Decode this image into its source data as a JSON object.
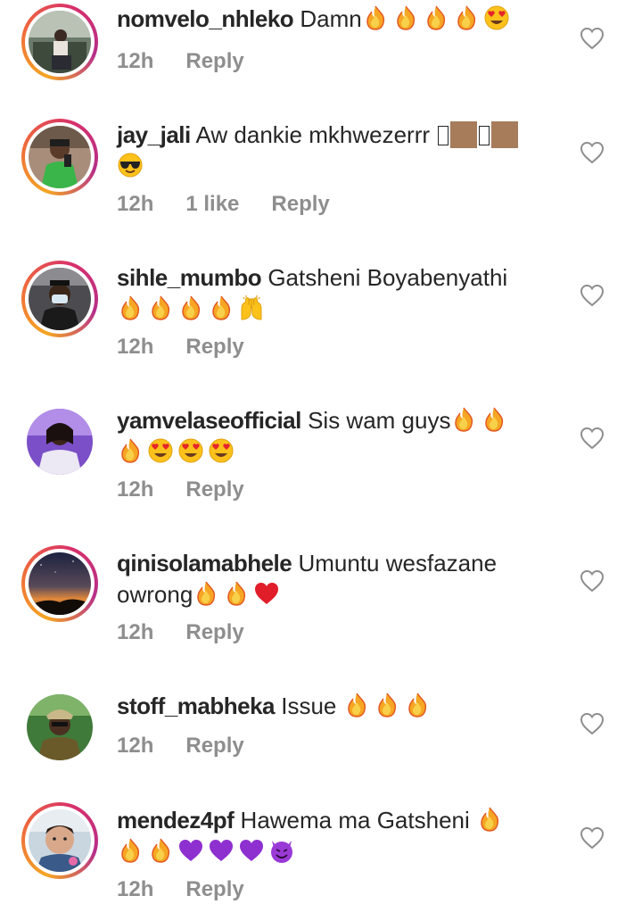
{
  "comments": [
    {
      "username": "nomvelo_nhleko",
      "text": "Damn",
      "line2": "",
      "emoji_line1": [
        "fire-emoji",
        "fire-emoji",
        "fire-emoji",
        "fire-emoji",
        "heart-eyes-emoji"
      ],
      "emoji_line2": [],
      "time": "12h",
      "likes": "",
      "reply": "Reply",
      "avatar": "avatar-photo-man-outdoor",
      "story_ring": true
    },
    {
      "username": "jay_jali",
      "text": "Aw dankie mkhwezerrr",
      "line2": "",
      "emoji_line1": [
        "unrendered-glyph",
        "skin-tone-medium",
        "unrendered-glyph",
        "skin-tone-medium"
      ],
      "emoji_line2": [
        "sunglasses-emoji"
      ],
      "time": "12h",
      "likes": "1 like",
      "reply": "Reply",
      "avatar": "avatar-photo-woman-green",
      "story_ring": true
    },
    {
      "username": "sihle_mumbo",
      "text": "Gatsheni Boyabenyathi",
      "line2": "",
      "emoji_line1": [],
      "emoji_line2": [
        "fire-emoji",
        "fire-emoji",
        "fire-emoji",
        "fire-emoji",
        "raising-hands-emoji"
      ],
      "time": "12h",
      "likes": "",
      "reply": "Reply",
      "avatar": "avatar-photo-man-mask",
      "story_ring": true
    },
    {
      "username": "yamvelaseofficial",
      "text": "Sis wam guys",
      "line2": "",
      "emoji_line1": [
        "fire-emoji",
        "fire-emoji"
      ],
      "emoji_line2": [
        "fire-emoji",
        "heart-eyes-emoji",
        "heart-eyes-emoji",
        "heart-eyes-emoji"
      ],
      "time": "12h",
      "likes": "",
      "reply": "Reply",
      "avatar": "avatar-photo-woman-purple",
      "story_ring": false
    },
    {
      "username": "qinisolamabhele",
      "text": "Umuntu wesfazane",
      "line2": "owrong",
      "emoji_line1": [],
      "emoji_line2": [
        "fire-emoji",
        "fire-emoji",
        "red-heart-emoji"
      ],
      "time": "12h",
      "likes": "",
      "reply": "Reply",
      "avatar": "avatar-photo-sunset",
      "story_ring": true
    },
    {
      "username": "stoff_mabheka",
      "text": "Issue",
      "line2": "",
      "emoji_line1": [
        "fire-emoji",
        "fire-emoji",
        "fire-emoji"
      ],
      "emoji_line2": [],
      "time": "12h",
      "likes": "",
      "reply": "Reply",
      "avatar": "avatar-photo-man-cap",
      "story_ring": false
    },
    {
      "username": "mendez4pf",
      "text": "Hawema ma Gatsheni",
      "line2": "",
      "emoji_line1": [
        "fire-emoji"
      ],
      "emoji_line2": [
        "fire-emoji",
        "fire-emoji",
        "purple-heart-emoji",
        "purple-heart-emoji",
        "purple-heart-emoji",
        "smiling-devil-emoji"
      ],
      "time": "12h",
      "likes": "",
      "reply": "Reply",
      "avatar": "avatar-photo-child",
      "story_ring": true
    }
  ],
  "colors": {
    "text": "#262626",
    "meta": "#8e8e8e",
    "ring_start": "#f5a623",
    "ring_end": "#b62f8a"
  }
}
